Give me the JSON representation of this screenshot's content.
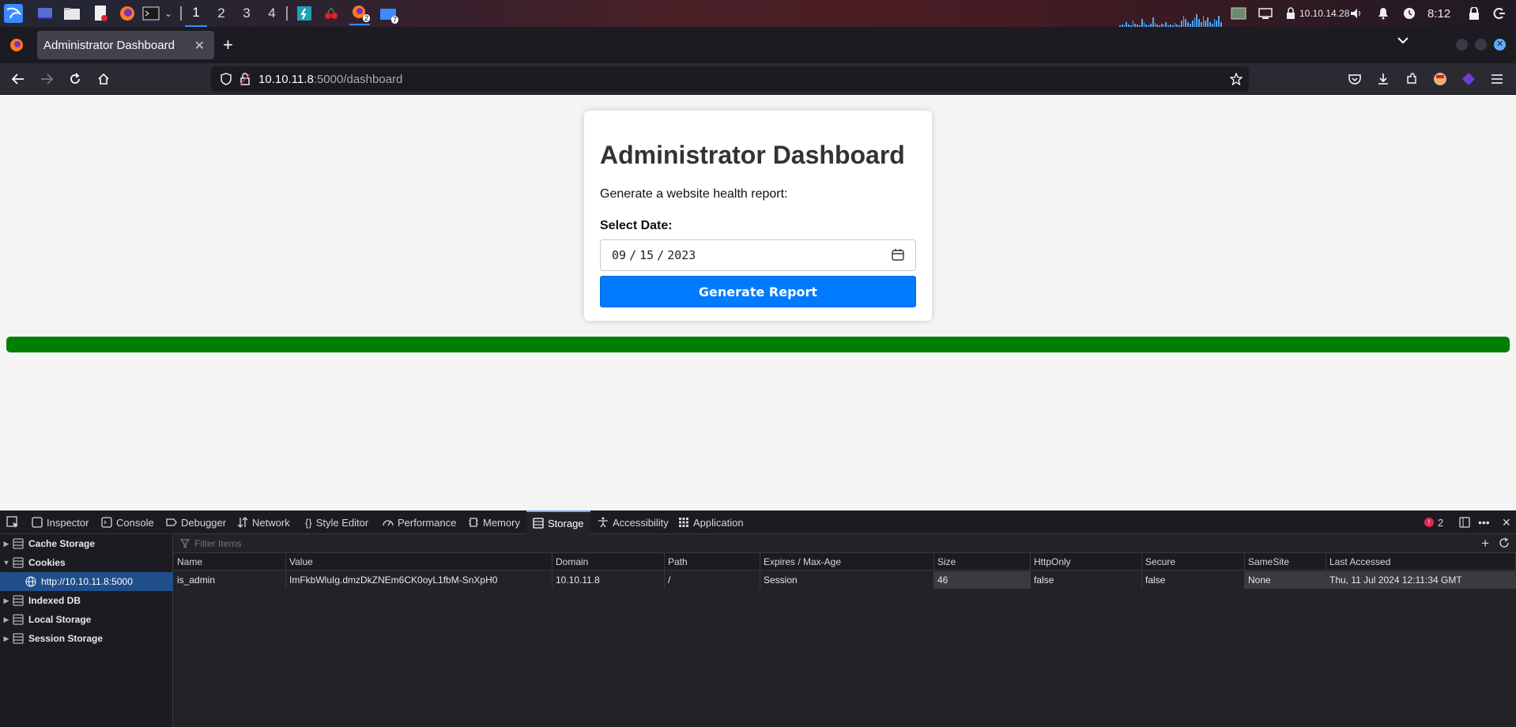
{
  "taskbar": {
    "workspaces": [
      "1",
      "2",
      "3",
      "4"
    ],
    "active_workspace": "1",
    "firefox_badge": "2",
    "files_badge": "7",
    "ip": "10.10.14.28",
    "time": "8:12"
  },
  "browser": {
    "tab_title": "Administrator Dashboard",
    "url_host": "10.10.11.8",
    "url_rest": ":5000/dashboard"
  },
  "page": {
    "heading": "Administrator Dashboard",
    "subtitle": "Generate a website health report:",
    "date_label": "Select Date:",
    "date_month": "09",
    "date_day": "15",
    "date_year": "2023",
    "button": "Generate Report",
    "progress_fraction": 1.0,
    "progress_color": "#008000"
  },
  "devtools": {
    "tabs": [
      "Inspector",
      "Console",
      "Debugger",
      "Network",
      "Style Editor",
      "Performance",
      "Memory",
      "Storage",
      "Accessibility",
      "Application"
    ],
    "selected_tab": "Storage",
    "error_count": "2",
    "sidebar": [
      "Cache Storage",
      "Cookies",
      "http://10.10.11.8:5000",
      "Indexed DB",
      "Local Storage",
      "Session Storage"
    ],
    "filter_placeholder": "Filter Items",
    "columns": [
      "Name",
      "Value",
      "Domain",
      "Path",
      "Expires / Max-Age",
      "Size",
      "HttpOnly",
      "Secure",
      "SameSite",
      "Last Accessed"
    ],
    "rows": [
      [
        "is_admin",
        "ImFkbWluIg.dmzDkZNEm6CK0oyL1fbM-SnXpH0",
        "10.10.11.8",
        "/",
        "Session",
        "46",
        "false",
        "false",
        "None",
        "Thu, 11 Jul 2024 12:11:34 GMT"
      ]
    ]
  }
}
